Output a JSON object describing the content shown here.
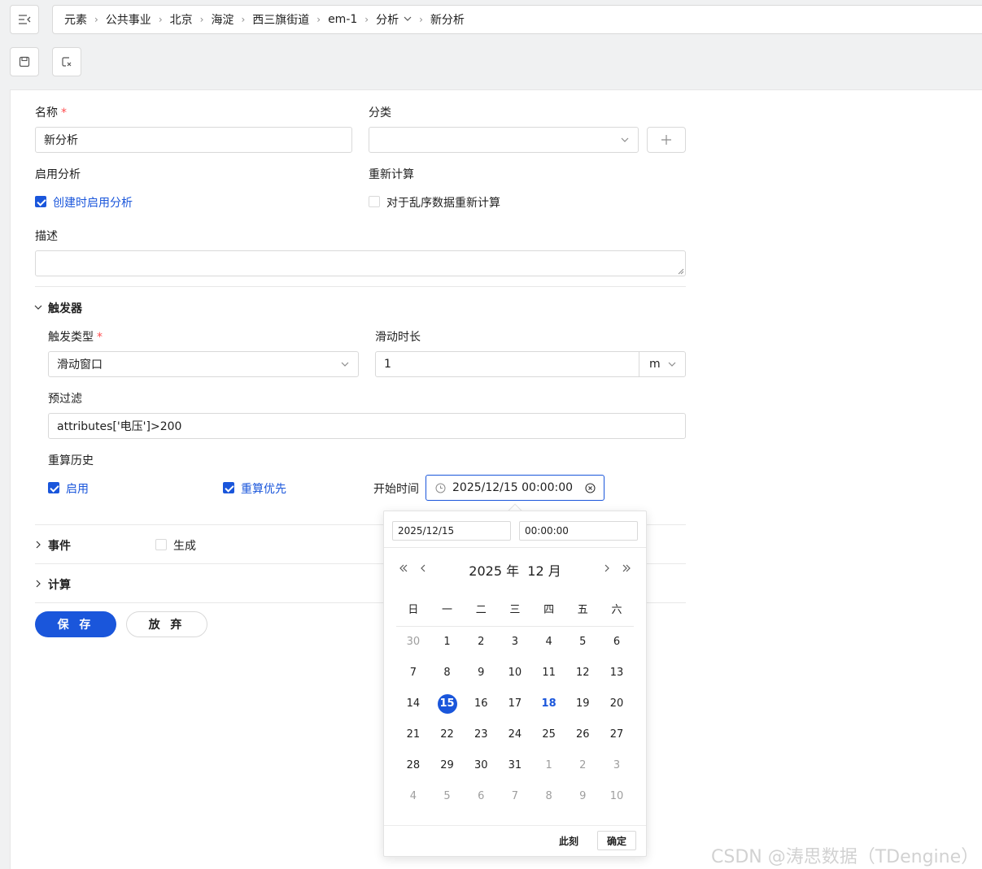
{
  "breadcrumb": [
    "元素",
    "公共事业",
    "北京",
    "海淀",
    "西三旗街道",
    "em-1",
    "分析",
    "新分析"
  ],
  "form": {
    "name_label": "名称",
    "name_value": "新分析",
    "category_label": "分类",
    "category_value": "",
    "enable_label": "启用分析",
    "enable_checkbox": "创建时启用分析",
    "recalc_label": "重新计算",
    "recalc_checkbox": "对于乱序数据重新计算",
    "desc_label": "描述",
    "desc_value": ""
  },
  "trigger": {
    "section": "触发器",
    "type_label": "触发类型",
    "type_value": "滑动窗口",
    "duration_label": "滑动时长",
    "duration_value": "1",
    "duration_unit": "m",
    "filter_label": "预过滤",
    "filter_value": "attributes['电压']>200",
    "history_label": "重算历史",
    "history_enable": "启用",
    "history_priority": "重算优先",
    "start_label": "开始时间",
    "start_value": "2025/12/15 00:00:00"
  },
  "events": {
    "section": "事件",
    "generate": "生成"
  },
  "calc": {
    "section": "计算"
  },
  "buttons": {
    "save": "保 存",
    "discard": "放 弃"
  },
  "picker": {
    "date_input": "2025/12/15",
    "time_input": "00:00:00",
    "year": "2025 年",
    "month": "12 月",
    "weekdays": [
      "日",
      "一",
      "二",
      "三",
      "四",
      "五",
      "六"
    ],
    "weeks": [
      [
        "30",
        "1",
        "2",
        "3",
        "4",
        "5",
        "6"
      ],
      [
        "7",
        "8",
        "9",
        "10",
        "11",
        "12",
        "13"
      ],
      [
        "14",
        "15",
        "16",
        "17",
        "18",
        "19",
        "20"
      ],
      [
        "21",
        "22",
        "23",
        "24",
        "25",
        "26",
        "27"
      ],
      [
        "28",
        "29",
        "30",
        "31",
        "1",
        "2",
        "3"
      ],
      [
        "4",
        "5",
        "6",
        "7",
        "8",
        "9",
        "10"
      ]
    ],
    "selected": "15",
    "today": "18",
    "now_label": "此刻",
    "ok_label": "确定"
  },
  "watermark": "CSDN @涛思数据（TDengine）",
  "colors": {
    "accent": "#1a56db",
    "required": "#ff4d4f"
  }
}
